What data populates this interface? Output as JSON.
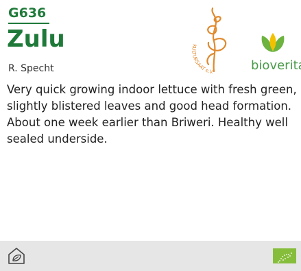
{
  "product": {
    "code": "G636",
    "name": "Zulu",
    "breeder": "R. Specht",
    "description": "Very quick growing indoor lettuce with fresh green, slightly blistered leaves and good head formation. About one week earlier than Briweri. Healthy well sealed underside."
  },
  "logos": {
    "kultursaat_text": "KULTURSAAT e.V.",
    "bioverita_text": "bioverita"
  },
  "footer": {
    "greenhouse_icon": "greenhouse-leaf-icon",
    "eu_organic_icon": "eu-organic-leaf-icon"
  },
  "colors": {
    "brand_green": "#1f7a3a",
    "kultursaat_orange": "#e08a2e",
    "bioverita_green": "#6cb33f",
    "footer_bg": "#e6e6e6",
    "eu_leaf_green": "#86be3c"
  }
}
